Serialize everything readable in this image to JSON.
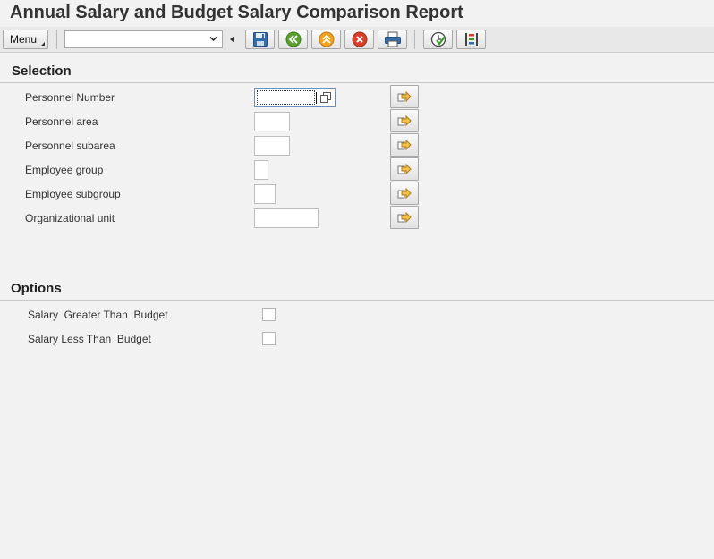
{
  "title": "Annual Salary and Budget Salary Comparison Report",
  "toolbar": {
    "menu_label": "Menu",
    "command_value": "",
    "buttons": [
      {
        "icon": "save-icon"
      },
      {
        "icon": "back-icon"
      },
      {
        "icon": "exit-icon"
      },
      {
        "icon": "cancel-icon"
      },
      {
        "icon": "print-icon"
      },
      {
        "icon": "execute-icon"
      },
      {
        "icon": "get-variant-icon"
      }
    ]
  },
  "selection": {
    "title": "Selection",
    "fields": [
      {
        "label": "Personnel Number",
        "value": ""
      },
      {
        "label": "Personnel area",
        "value": ""
      },
      {
        "label": "Personnel subarea",
        "value": ""
      },
      {
        "label": "Employee group",
        "value": ""
      },
      {
        "label": "Employee subgroup",
        "value": ""
      },
      {
        "label": "Organizational unit",
        "value": ""
      }
    ]
  },
  "options": {
    "title": "Options",
    "items": [
      {
        "label": "Salary  Greater Than  Budget",
        "checked": false
      },
      {
        "label": "Salary Less Than  Budget",
        "checked": false
      }
    ]
  },
  "colors": {
    "background": "#f2f2f2",
    "toolbar": "#e8e8e8",
    "field_border": "#bdbdbd",
    "focus_border": "#6a8fb8"
  }
}
